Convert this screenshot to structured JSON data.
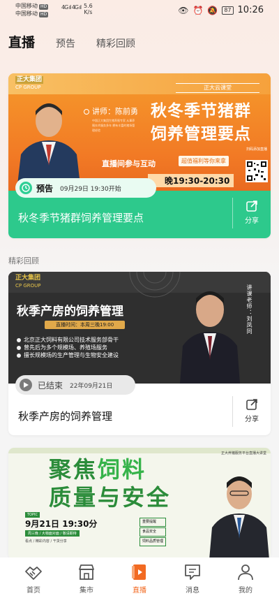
{
  "status_bar": {
    "carrier1": "中国移动",
    "carrier2": "中国移动",
    "hd": "HD",
    "signal": "4G ıl 4G ıl",
    "speed": "5.6",
    "speed_unit": "K/s",
    "battery": "87",
    "time": "10:26"
  },
  "tabs": [
    {
      "label": "直播",
      "active": true
    },
    {
      "label": "预告",
      "active": false
    },
    {
      "label": "精彩回顾",
      "active": false
    }
  ],
  "card1": {
    "logo_cn": "正大集团",
    "logo_en": "CP GROUP",
    "brand": "正大云课堂",
    "lecturer": "讲师：陈前勇",
    "desc": "中国正大集团生猪养殖专家 从事养殖技术服务多年 拥有丰富的猪场管理经验",
    "banner_title_line1": "秋冬季节猪群",
    "banner_title_line2": "饲养管理要点",
    "live_text": "直播间参与互动",
    "badge": "超值福利等你来拿",
    "qr_label": "扫码添加直播",
    "timeline": "晚19:30-20:30",
    "status": "预告",
    "start_time": "09月29日 19:30开始",
    "title": "秋冬季节猪群饲养管理要点",
    "share": "分享"
  },
  "section_label": "精彩回顾",
  "card2": {
    "logo_cn": "正大集团",
    "logo_en": "CP GROUP",
    "banner_title": "秋季产房的饲养管理",
    "live_time": "直播时间：本周三晚19:00",
    "bullets": [
      "北京正大饲料有限公司技术服务部骨干",
      "曾先后为多个规模场、养殖场服务",
      "擅长规模场的生产管理与生物安全建设"
    ],
    "teacher": "讲课老师：刘凤同",
    "status": "已结束",
    "date": "22年09月21日",
    "title": "秋季产房的饲养管理",
    "share": "分享"
  },
  "card3": {
    "brand": "正大养猪服务平台直播大讲堂",
    "title1_a": "聚焦",
    "title1_b": "饲料",
    "title2": "质量与安全",
    "topic": "TOPIC",
    "date": "9月21日 19:30分",
    "sub": "周三晚 / 大咖面对面 / 敬请期待",
    "sub2": "看点 / 精彩内容 / 干货分享",
    "tags": [
      "重要提醒",
      "食品安全",
      "饲料品质管理"
    ]
  },
  "bottom_nav": [
    {
      "label": "首页",
      "icon": "handshake-icon",
      "active": false
    },
    {
      "label": "集市",
      "icon": "store-icon",
      "active": false
    },
    {
      "label": "直播",
      "icon": "live-icon",
      "active": true
    },
    {
      "label": "消息",
      "icon": "message-icon",
      "active": false
    },
    {
      "label": "我的",
      "icon": "user-icon",
      "active": false
    }
  ],
  "colors": {
    "accent": "#f26a22",
    "green": "#2dc98c"
  }
}
